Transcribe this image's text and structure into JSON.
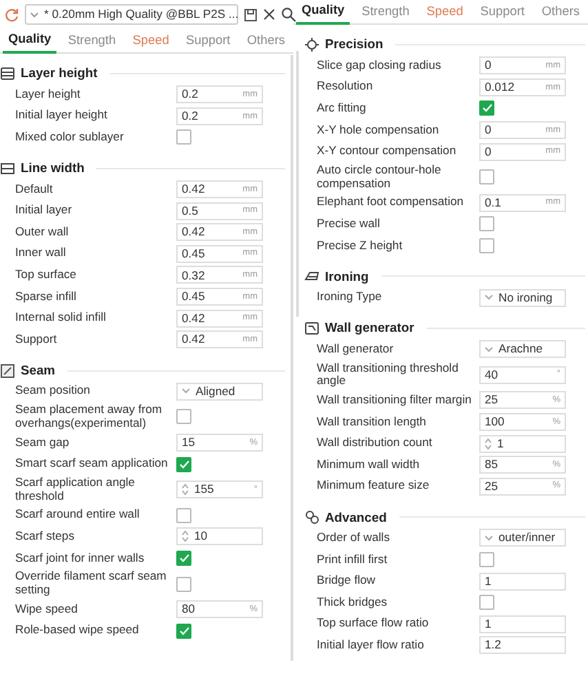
{
  "panels": [
    {
      "preset": {
        "value": "* 0.20mm High Quality @BBL P2S ..."
      },
      "tabs": [
        {
          "label": "Quality",
          "selected": true,
          "modified": false
        },
        {
          "label": "Strength",
          "selected": false,
          "modified": false
        },
        {
          "label": "Speed",
          "selected": false,
          "modified": true
        },
        {
          "label": "Support",
          "selected": false,
          "modified": false
        },
        {
          "label": "Others",
          "selected": false,
          "modified": false
        }
      ],
      "sections": [
        {
          "title": "Layer height",
          "rows": [
            {
              "label": "Layer height",
              "kind": "input",
              "value": "0.2",
              "unit": "mm"
            },
            {
              "label": "Initial layer height",
              "kind": "input",
              "value": "0.2",
              "unit": "mm"
            },
            {
              "label": "Mixed color sublayer",
              "kind": "checkbox",
              "checked": false
            }
          ]
        },
        {
          "title": "Line width",
          "rows": [
            {
              "label": "Default",
              "kind": "input",
              "value": "0.42",
              "unit": "mm"
            },
            {
              "label": "Initial layer",
              "kind": "input",
              "value": "0.5",
              "unit": "mm"
            },
            {
              "label": "Outer wall",
              "kind": "input",
              "value": "0.42",
              "unit": "mm"
            },
            {
              "label": "Inner wall",
              "kind": "input",
              "value": "0.45",
              "unit": "mm"
            },
            {
              "label": "Top surface",
              "kind": "input",
              "value": "0.32",
              "unit": "mm"
            },
            {
              "label": "Sparse infill",
              "kind": "input",
              "value": "0.45",
              "unit": "mm"
            },
            {
              "label": "Internal solid infill",
              "kind": "input",
              "value": "0.42",
              "unit": "mm"
            },
            {
              "label": "Support",
              "kind": "input",
              "value": "0.42",
              "unit": "mm"
            }
          ]
        },
        {
          "title": "Seam",
          "rows": [
            {
              "label": "Seam position",
              "kind": "select",
              "value": "Aligned"
            },
            {
              "label": "Seam placement away from overhangs(experimental)",
              "kind": "checkbox",
              "checked": false
            },
            {
              "label": "Seam gap",
              "kind": "input",
              "value": "15",
              "unit": "%"
            },
            {
              "label": "Smart scarf seam application",
              "kind": "checkbox",
              "checked": true
            },
            {
              "label": "Scarf application angle threshold",
              "kind": "spin",
              "value": "155",
              "unit": "°"
            },
            {
              "label": "Scarf around entire wall",
              "kind": "checkbox",
              "checked": false
            },
            {
              "label": "Scarf steps",
              "kind": "spin",
              "value": "10"
            },
            {
              "label": "Scarf joint for inner walls",
              "kind": "checkbox",
              "checked": true
            },
            {
              "label": "Override filament scarf seam setting",
              "kind": "checkbox",
              "checked": false
            },
            {
              "label": "Wipe speed",
              "kind": "input",
              "value": "80",
              "unit": "%"
            },
            {
              "label": "Role-based wipe speed",
              "kind": "checkbox",
              "checked": true
            }
          ]
        }
      ]
    },
    {
      "tabs": [
        {
          "label": "Quality",
          "selected": true,
          "modified": false
        },
        {
          "label": "Strength",
          "selected": false,
          "modified": false
        },
        {
          "label": "Speed",
          "selected": false,
          "modified": true
        },
        {
          "label": "Support",
          "selected": false,
          "modified": false
        },
        {
          "label": "Others",
          "selected": false,
          "modified": false
        }
      ],
      "sections": [
        {
          "title": "Precision",
          "rows": [
            {
              "label": "Slice gap closing radius",
              "kind": "input",
              "value": "0",
              "unit": "mm"
            },
            {
              "label": "Resolution",
              "kind": "input",
              "value": "0.012",
              "unit": "mm"
            },
            {
              "label": "Arc fitting",
              "kind": "checkbox",
              "checked": true
            },
            {
              "label": "X-Y hole compensation",
              "kind": "input",
              "value": "0",
              "unit": "mm"
            },
            {
              "label": "X-Y contour compensation",
              "kind": "input",
              "value": "0",
              "unit": "mm"
            },
            {
              "label": "Auto circle contour-hole compensation",
              "kind": "checkbox",
              "checked": false
            },
            {
              "label": "Elephant foot compensation",
              "kind": "input",
              "value": "0.1",
              "unit": "mm"
            },
            {
              "label": "Precise wall",
              "kind": "checkbox",
              "checked": false
            },
            {
              "label": "Precise Z height",
              "kind": "checkbox",
              "checked": false
            }
          ]
        },
        {
          "title": "Ironing",
          "rows": [
            {
              "label": "Ironing Type",
              "kind": "select",
              "value": "No ironing"
            }
          ]
        },
        {
          "title": "Wall generator",
          "rows": [
            {
              "label": "Wall generator",
              "kind": "select",
              "value": "Arachne"
            },
            {
              "label": "Wall transitioning threshold angle",
              "kind": "input",
              "value": "40",
              "unit": "°"
            },
            {
              "label": "Wall transitioning filter margin",
              "kind": "input",
              "value": "25",
              "unit": "%"
            },
            {
              "label": "Wall transition length",
              "kind": "input",
              "value": "100",
              "unit": "%"
            },
            {
              "label": "Wall distribution count",
              "kind": "spin",
              "value": "1"
            },
            {
              "label": "Minimum wall width",
              "kind": "input",
              "value": "85",
              "unit": "%"
            },
            {
              "label": "Minimum feature size",
              "kind": "input",
              "value": "25",
              "unit": "%"
            }
          ]
        },
        {
          "title": "Advanced",
          "rows": [
            {
              "label": "Order of walls",
              "kind": "select",
              "value": "outer/inner"
            },
            {
              "label": "Print infill first",
              "kind": "checkbox",
              "checked": false
            },
            {
              "label": "Bridge flow",
              "kind": "input",
              "value": "1"
            },
            {
              "label": "Thick bridges",
              "kind": "checkbox",
              "checked": false
            },
            {
              "label": "Top surface flow ratio",
              "kind": "input",
              "value": "1"
            },
            {
              "label": "Initial layer flow ratio",
              "kind": "input",
              "value": "1.2"
            }
          ]
        }
      ]
    }
  ]
}
